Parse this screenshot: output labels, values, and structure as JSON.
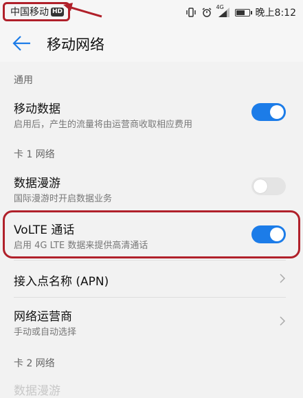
{
  "status_bar": {
    "carrier": "中国移动",
    "hd_badge": "HD",
    "network": "4G",
    "time": "晚上8:12",
    "battery_level": 0.75,
    "icons": [
      "vibrate-icon",
      "alarm-icon",
      "signal-icon",
      "battery-icon"
    ]
  },
  "header": {
    "title": "移动网络",
    "back_icon": "arrow-left-icon"
  },
  "sections": {
    "general": "通用",
    "sim1": "卡 1 网络",
    "sim2": "卡 2 网络"
  },
  "rows": {
    "mobile_data": {
      "title": "移动数据",
      "subtitle": "启用后，产生的流量将由运营商收取相应费用",
      "enabled": true
    },
    "data_roaming": {
      "title": "数据漫游",
      "subtitle": "国际漫游时开启数据业务",
      "enabled": false
    },
    "volte": {
      "title": "VoLTE 通话",
      "subtitle": "启用 4G LTE 数据来提供高清通话",
      "enabled": true
    },
    "apn": {
      "title": "接入点名称 (APN)"
    },
    "carrier": {
      "title": "网络运营商",
      "subtitle": "手动或自动选择"
    },
    "sim2_roaming": {
      "title": "数据漫游"
    }
  },
  "colors": {
    "accent": "#1c7ce8",
    "annotation": "#b0202a"
  }
}
